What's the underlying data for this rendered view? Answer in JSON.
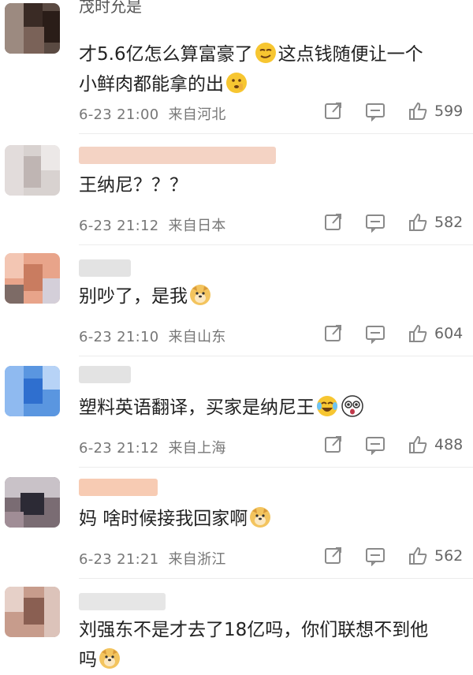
{
  "colors": {
    "meta_text": "#777777",
    "body_text": "#222222",
    "icon": "#8a8a8a",
    "name_blur": "#f4d3c4"
  },
  "comments": [
    {
      "name": "茂时允是",
      "text1": "才5.6亿怎么算富豪了",
      "emoji1": "smirk-emoji",
      "text2": "这点钱随便让一个",
      "line2": "小鲜肉都能拿的出",
      "emoji2": "hush-emoji",
      "date": "6-23 21:00",
      "location": "来自河北",
      "likes": "599"
    },
    {
      "name": "",
      "text1": "王纳尼？？？",
      "date": "6-23 21:12",
      "location": "来自日本",
      "likes": "582"
    },
    {
      "name": "",
      "text1": "别吵了，是我",
      "emoji1": "doge-emoji",
      "date": "6-23 21:10",
      "location": "来自山东",
      "likes": "604"
    },
    {
      "name": "",
      "text1": "塑料英语翻译，买家是纳尼王",
      "emoji1": "laugh-cry-emoji",
      "emoji2": "shocked-emoji",
      "date": "6-23 21:12",
      "location": "来自上海",
      "likes": "488"
    },
    {
      "name": "",
      "text1": "妈 啥时候接我回家啊",
      "emoji1": "doge-emoji",
      "date": "6-23 21:21",
      "location": "来自浙江",
      "likes": "562"
    },
    {
      "name": "",
      "text1": "刘强东不是才去了18亿吗，你们联想不到他",
      "line2": "吗",
      "emoji2": "doge-emoji"
    }
  ]
}
